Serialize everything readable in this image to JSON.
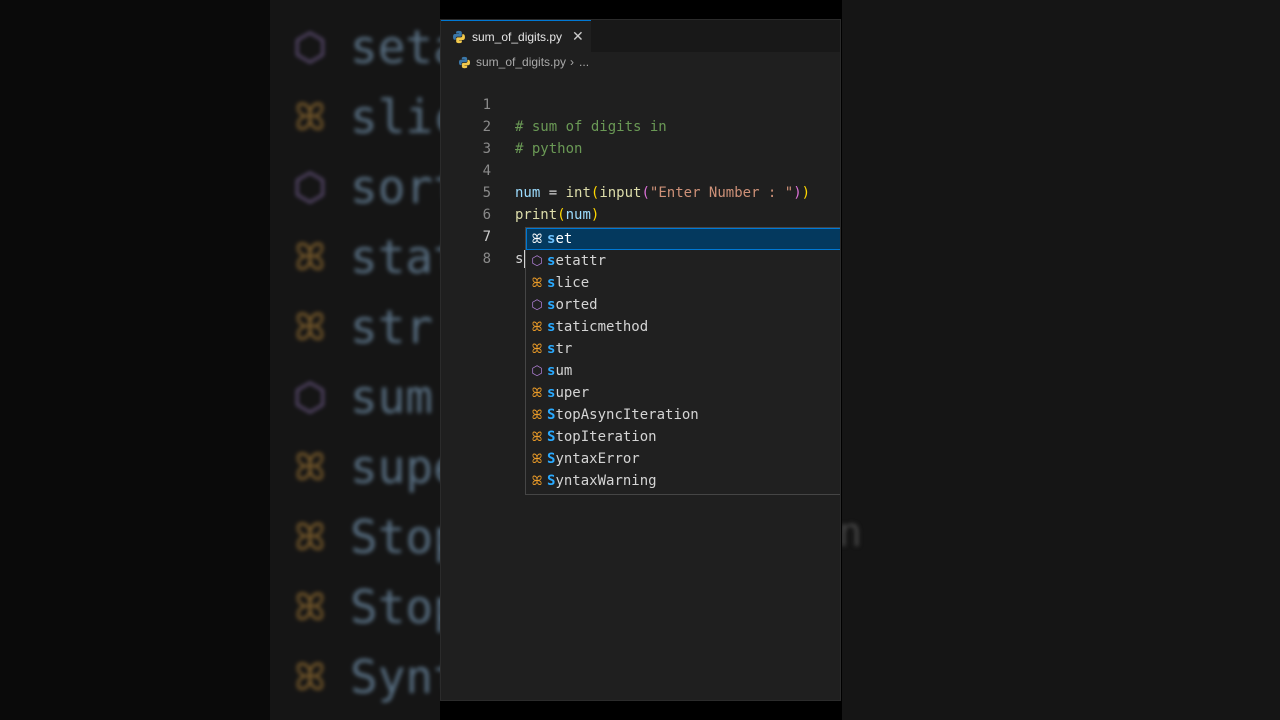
{
  "backdrop": {
    "items": [
      {
        "icon": "method-icon",
        "label": "seta"
      },
      {
        "icon": "class-icon",
        "label": "slic"
      },
      {
        "icon": "method-icon",
        "label": "sort"
      },
      {
        "icon": "class-icon",
        "label": "stat"
      },
      {
        "icon": "class-icon",
        "label": "str"
      },
      {
        "icon": "method-icon",
        "label": "sum"
      },
      {
        "icon": "class-icon",
        "label": "supe"
      },
      {
        "icon": "class-icon",
        "label": "Stop"
      },
      {
        "icon": "class-icon",
        "label": "Stop"
      },
      {
        "icon": "class-icon",
        "label": "Synt"
      }
    ],
    "right_stub": "n"
  },
  "tab": {
    "label": "sum_of_digits.py",
    "close_glyph": "✕",
    "icon": "python-icon"
  },
  "breadcrumb": {
    "file": "sum_of_digits.py",
    "separator": "›",
    "more": "..."
  },
  "code": {
    "line_numbers": [
      "1",
      "2",
      "3",
      "4",
      "5",
      "6",
      "7",
      "8"
    ],
    "line1": "# sum of digits in",
    "line2": "# python",
    "line4": {
      "var": "num",
      "eq": " = ",
      "fn1": "int",
      "open1": "(",
      "fn2": "input",
      "open2": "(",
      "str": "\"Enter Number : \"",
      "close2": ")",
      "close1": ")"
    },
    "line5": {
      "fn": "print",
      "open": "(",
      "arg": "num",
      "close": ")"
    },
    "line7": "s"
  },
  "suggest": {
    "items": [
      {
        "kind": "class",
        "match": "s",
        "rest": "et"
      },
      {
        "kind": "method",
        "match": "s",
        "rest": "etattr"
      },
      {
        "kind": "class",
        "match": "s",
        "rest": "lice"
      },
      {
        "kind": "method",
        "match": "s",
        "rest": "orted"
      },
      {
        "kind": "class",
        "match": "s",
        "rest": "taticmethod"
      },
      {
        "kind": "class",
        "match": "s",
        "rest": "tr"
      },
      {
        "kind": "method",
        "match": "s",
        "rest": "um"
      },
      {
        "kind": "class",
        "match": "s",
        "rest": "uper"
      },
      {
        "kind": "class",
        "match": "S",
        "rest": "topAsyncIteration"
      },
      {
        "kind": "class",
        "match": "S",
        "rest": "topIteration"
      },
      {
        "kind": "class",
        "match": "S",
        "rest": "yntaxError"
      },
      {
        "kind": "class",
        "match": "S",
        "rest": "yntaxWarning"
      }
    ],
    "selected_index": 0
  },
  "colors": {
    "accent": "#0078d4",
    "method_icon": "#b180d7",
    "class_icon": "#ee9d28",
    "match_highlight": "#2aaaff"
  }
}
